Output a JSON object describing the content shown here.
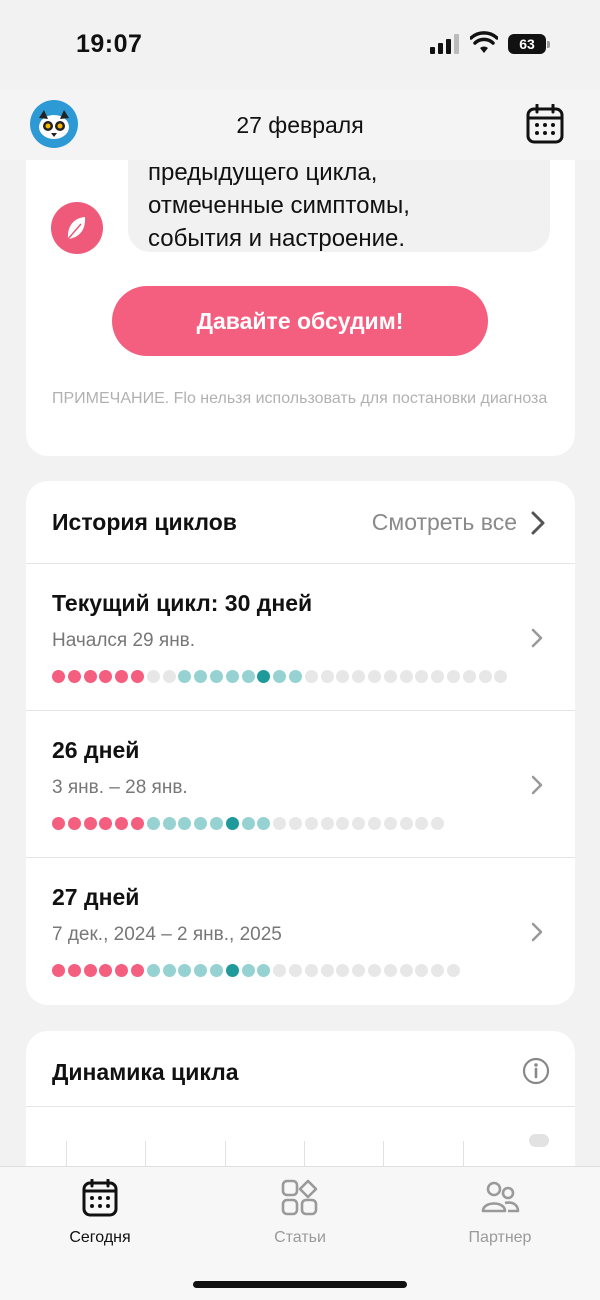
{
  "status_bar": {
    "time": "19:07",
    "battery": "63"
  },
  "header": {
    "date_title": "27 февраля",
    "avatar_icon": "lemur-avatar-icon",
    "calendar_icon": "calendar-icon"
  },
  "ai_card": {
    "message_lines": [
      "предыдущего цикла,",
      "отмеченные симптомы,",
      "события и настроение."
    ],
    "cta_label": "Давайте обсудим!",
    "note": "ПРИМЕЧАНИЕ. Flo нельзя использовать для постановки диагноза"
  },
  "cycle_history": {
    "title": "История циклов",
    "see_all": "Смотреть все",
    "cycles": [
      {
        "title": "Текущий цикл: 30 дней",
        "dates": "Начался 29 янв.",
        "days": "pppppplllllllllllllllllllllll",
        "pattern": "pppppp.ttttt.T.tt.lllllllllllll"
      },
      {
        "title": "26 дней",
        "dates": "3 янв. – 28 янв.",
        "pattern": "pppppptttttTttlllllllllll"
      },
      {
        "title": "27 дней",
        "dates": "7 дек., 2024 – 2 янв., 2025",
        "pattern": "pppppptttttTttllllllllllll"
      }
    ]
  },
  "dynamics": {
    "title": "Динамика цикла"
  },
  "tabbar": {
    "tabs": [
      {
        "label": "Сегодня",
        "icon": "calendar-icon",
        "active": true
      },
      {
        "label": "Статьи",
        "icon": "articles-grid-icon",
        "active": false
      },
      {
        "label": "Партнер",
        "icon": "partner-icon",
        "active": false
      }
    ]
  },
  "colors": {
    "period": "#f45e7f",
    "fertile": "#95d2d1",
    "ovulation": "#1f9a9a",
    "other": "#e7e7e7",
    "accent": "#f45e7f"
  }
}
